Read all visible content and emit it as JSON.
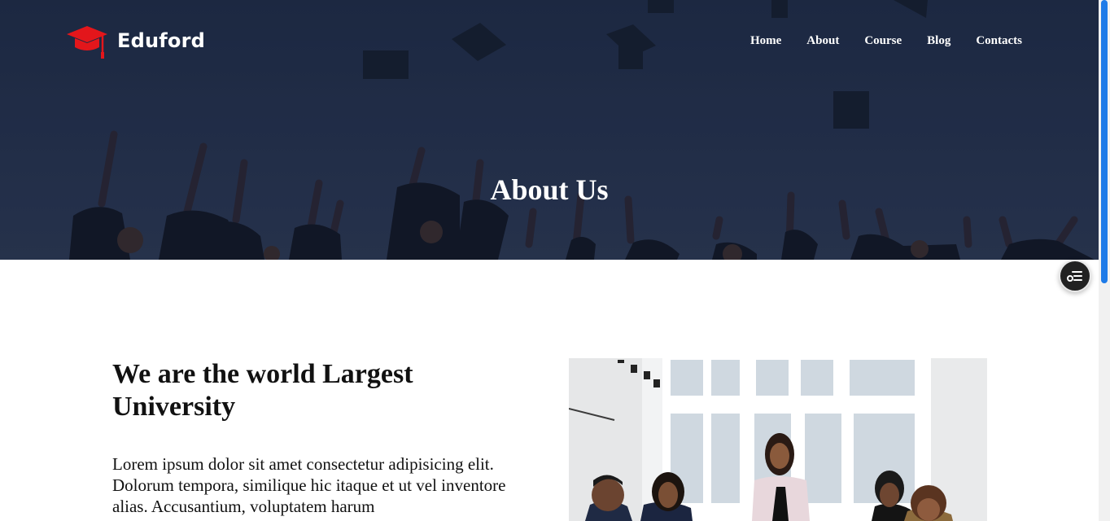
{
  "header": {
    "logo_text": "Eduford",
    "nav": [
      "Home",
      "About",
      "Course",
      "Blog",
      "Contacts"
    ]
  },
  "hero": {
    "title": "About Us"
  },
  "about": {
    "heading": "We are the world Largest University",
    "text": "Lorem ipsum dolor sit amet consectetur adipisicing elit. Dolorum tempora, similique hic itaque et ut vel inventore alias. Accusantium, voluptatem harum"
  },
  "colors": {
    "hero_bg": "#26324d",
    "logo_accent": "#e3161b",
    "scroll_accent": "#1e7be8"
  }
}
